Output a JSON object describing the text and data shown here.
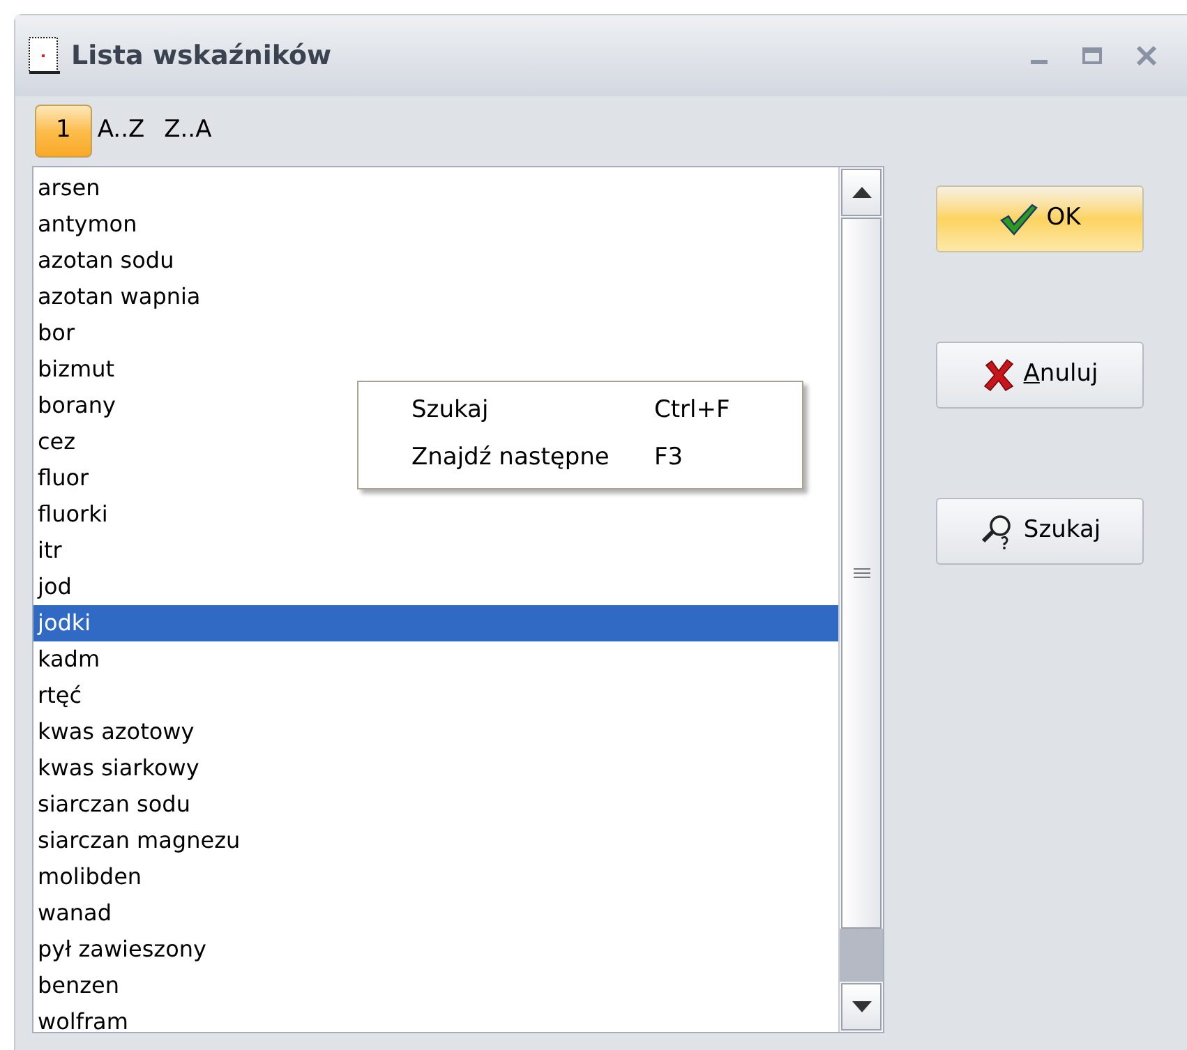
{
  "window": {
    "title": "Lista wskaźników"
  },
  "sort_options": [
    {
      "label": "1",
      "selected": true
    },
    {
      "label": "A..Z",
      "selected": false
    },
    {
      "label": "Z..A",
      "selected": false
    }
  ],
  "list": {
    "items": [
      {
        "label": "arsen",
        "selected": false
      },
      {
        "label": "antymon",
        "selected": false
      },
      {
        "label": "azotan sodu",
        "selected": false
      },
      {
        "label": "azotan wapnia",
        "selected": false
      },
      {
        "label": "bor",
        "selected": false
      },
      {
        "label": "bizmut",
        "selected": false
      },
      {
        "label": "borany",
        "selected": false
      },
      {
        "label": "cez",
        "selected": false
      },
      {
        "label": "fluor",
        "selected": false
      },
      {
        "label": "fluorki",
        "selected": false
      },
      {
        "label": "itr",
        "selected": false
      },
      {
        "label": "jod",
        "selected": false
      },
      {
        "label": "jodki",
        "selected": true
      },
      {
        "label": "kadm",
        "selected": false
      },
      {
        "label": "rtęć",
        "selected": false
      },
      {
        "label": "kwas azotowy",
        "selected": false
      },
      {
        "label": "kwas siarkowy",
        "selected": false
      },
      {
        "label": "siarczan sodu",
        "selected": false
      },
      {
        "label": "siarczan magnezu",
        "selected": false
      },
      {
        "label": "molibden",
        "selected": false
      },
      {
        "label": "wanad",
        "selected": false
      },
      {
        "label": "pył zawieszony",
        "selected": false
      },
      {
        "label": "benzen",
        "selected": false
      },
      {
        "label": "wolfram",
        "selected": false
      }
    ]
  },
  "context_menu": {
    "items": [
      {
        "label": "Szukaj",
        "shortcut": "Ctrl+F"
      },
      {
        "label": "Znajdź następne",
        "shortcut": "F3"
      }
    ]
  },
  "buttons": [
    {
      "kind": "ok",
      "label": "OK",
      "default": true,
      "underline_first": false
    },
    {
      "kind": "cancel",
      "label": "Anuluj",
      "default": false,
      "underline_first": true
    },
    {
      "kind": "search",
      "label": "Szukaj",
      "default": false,
      "underline_first": false
    }
  ]
}
